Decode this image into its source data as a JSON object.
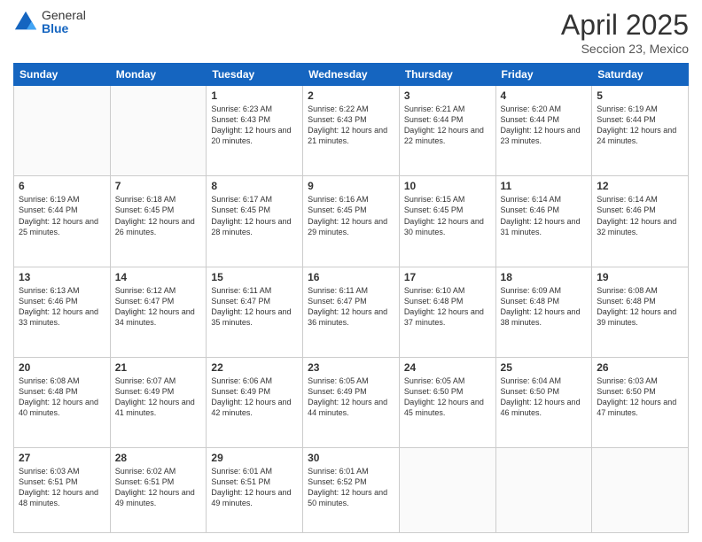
{
  "header": {
    "logo_general": "General",
    "logo_blue": "Blue",
    "month_title": "April 2025",
    "location": "Seccion 23, Mexico"
  },
  "days_of_week": [
    "Sunday",
    "Monday",
    "Tuesday",
    "Wednesday",
    "Thursday",
    "Friday",
    "Saturday"
  ],
  "weeks": [
    [
      {
        "day": "",
        "sunrise": "",
        "sunset": "",
        "daylight": ""
      },
      {
        "day": "",
        "sunrise": "",
        "sunset": "",
        "daylight": ""
      },
      {
        "day": "1",
        "sunrise": "Sunrise: 6:23 AM",
        "sunset": "Sunset: 6:43 PM",
        "daylight": "Daylight: 12 hours and 20 minutes."
      },
      {
        "day": "2",
        "sunrise": "Sunrise: 6:22 AM",
        "sunset": "Sunset: 6:43 PM",
        "daylight": "Daylight: 12 hours and 21 minutes."
      },
      {
        "day": "3",
        "sunrise": "Sunrise: 6:21 AM",
        "sunset": "Sunset: 6:44 PM",
        "daylight": "Daylight: 12 hours and 22 minutes."
      },
      {
        "day": "4",
        "sunrise": "Sunrise: 6:20 AM",
        "sunset": "Sunset: 6:44 PM",
        "daylight": "Daylight: 12 hours and 23 minutes."
      },
      {
        "day": "5",
        "sunrise": "Sunrise: 6:19 AM",
        "sunset": "Sunset: 6:44 PM",
        "daylight": "Daylight: 12 hours and 24 minutes."
      }
    ],
    [
      {
        "day": "6",
        "sunrise": "Sunrise: 6:19 AM",
        "sunset": "Sunset: 6:44 PM",
        "daylight": "Daylight: 12 hours and 25 minutes."
      },
      {
        "day": "7",
        "sunrise": "Sunrise: 6:18 AM",
        "sunset": "Sunset: 6:45 PM",
        "daylight": "Daylight: 12 hours and 26 minutes."
      },
      {
        "day": "8",
        "sunrise": "Sunrise: 6:17 AM",
        "sunset": "Sunset: 6:45 PM",
        "daylight": "Daylight: 12 hours and 28 minutes."
      },
      {
        "day": "9",
        "sunrise": "Sunrise: 6:16 AM",
        "sunset": "Sunset: 6:45 PM",
        "daylight": "Daylight: 12 hours and 29 minutes."
      },
      {
        "day": "10",
        "sunrise": "Sunrise: 6:15 AM",
        "sunset": "Sunset: 6:45 PM",
        "daylight": "Daylight: 12 hours and 30 minutes."
      },
      {
        "day": "11",
        "sunrise": "Sunrise: 6:14 AM",
        "sunset": "Sunset: 6:46 PM",
        "daylight": "Daylight: 12 hours and 31 minutes."
      },
      {
        "day": "12",
        "sunrise": "Sunrise: 6:14 AM",
        "sunset": "Sunset: 6:46 PM",
        "daylight": "Daylight: 12 hours and 32 minutes."
      }
    ],
    [
      {
        "day": "13",
        "sunrise": "Sunrise: 6:13 AM",
        "sunset": "Sunset: 6:46 PM",
        "daylight": "Daylight: 12 hours and 33 minutes."
      },
      {
        "day": "14",
        "sunrise": "Sunrise: 6:12 AM",
        "sunset": "Sunset: 6:47 PM",
        "daylight": "Daylight: 12 hours and 34 minutes."
      },
      {
        "day": "15",
        "sunrise": "Sunrise: 6:11 AM",
        "sunset": "Sunset: 6:47 PM",
        "daylight": "Daylight: 12 hours and 35 minutes."
      },
      {
        "day": "16",
        "sunrise": "Sunrise: 6:11 AM",
        "sunset": "Sunset: 6:47 PM",
        "daylight": "Daylight: 12 hours and 36 minutes."
      },
      {
        "day": "17",
        "sunrise": "Sunrise: 6:10 AM",
        "sunset": "Sunset: 6:48 PM",
        "daylight": "Daylight: 12 hours and 37 minutes."
      },
      {
        "day": "18",
        "sunrise": "Sunrise: 6:09 AM",
        "sunset": "Sunset: 6:48 PM",
        "daylight": "Daylight: 12 hours and 38 minutes."
      },
      {
        "day": "19",
        "sunrise": "Sunrise: 6:08 AM",
        "sunset": "Sunset: 6:48 PM",
        "daylight": "Daylight: 12 hours and 39 minutes."
      }
    ],
    [
      {
        "day": "20",
        "sunrise": "Sunrise: 6:08 AM",
        "sunset": "Sunset: 6:48 PM",
        "daylight": "Daylight: 12 hours and 40 minutes."
      },
      {
        "day": "21",
        "sunrise": "Sunrise: 6:07 AM",
        "sunset": "Sunset: 6:49 PM",
        "daylight": "Daylight: 12 hours and 41 minutes."
      },
      {
        "day": "22",
        "sunrise": "Sunrise: 6:06 AM",
        "sunset": "Sunset: 6:49 PM",
        "daylight": "Daylight: 12 hours and 42 minutes."
      },
      {
        "day": "23",
        "sunrise": "Sunrise: 6:05 AM",
        "sunset": "Sunset: 6:49 PM",
        "daylight": "Daylight: 12 hours and 44 minutes."
      },
      {
        "day": "24",
        "sunrise": "Sunrise: 6:05 AM",
        "sunset": "Sunset: 6:50 PM",
        "daylight": "Daylight: 12 hours and 45 minutes."
      },
      {
        "day": "25",
        "sunrise": "Sunrise: 6:04 AM",
        "sunset": "Sunset: 6:50 PM",
        "daylight": "Daylight: 12 hours and 46 minutes."
      },
      {
        "day": "26",
        "sunrise": "Sunrise: 6:03 AM",
        "sunset": "Sunset: 6:50 PM",
        "daylight": "Daylight: 12 hours and 47 minutes."
      }
    ],
    [
      {
        "day": "27",
        "sunrise": "Sunrise: 6:03 AM",
        "sunset": "Sunset: 6:51 PM",
        "daylight": "Daylight: 12 hours and 48 minutes."
      },
      {
        "day": "28",
        "sunrise": "Sunrise: 6:02 AM",
        "sunset": "Sunset: 6:51 PM",
        "daylight": "Daylight: 12 hours and 49 minutes."
      },
      {
        "day": "29",
        "sunrise": "Sunrise: 6:01 AM",
        "sunset": "Sunset: 6:51 PM",
        "daylight": "Daylight: 12 hours and 49 minutes."
      },
      {
        "day": "30",
        "sunrise": "Sunrise: 6:01 AM",
        "sunset": "Sunset: 6:52 PM",
        "daylight": "Daylight: 12 hours and 50 minutes."
      },
      {
        "day": "",
        "sunrise": "",
        "sunset": "",
        "daylight": ""
      },
      {
        "day": "",
        "sunrise": "",
        "sunset": "",
        "daylight": ""
      },
      {
        "day": "",
        "sunrise": "",
        "sunset": "",
        "daylight": ""
      }
    ]
  ]
}
